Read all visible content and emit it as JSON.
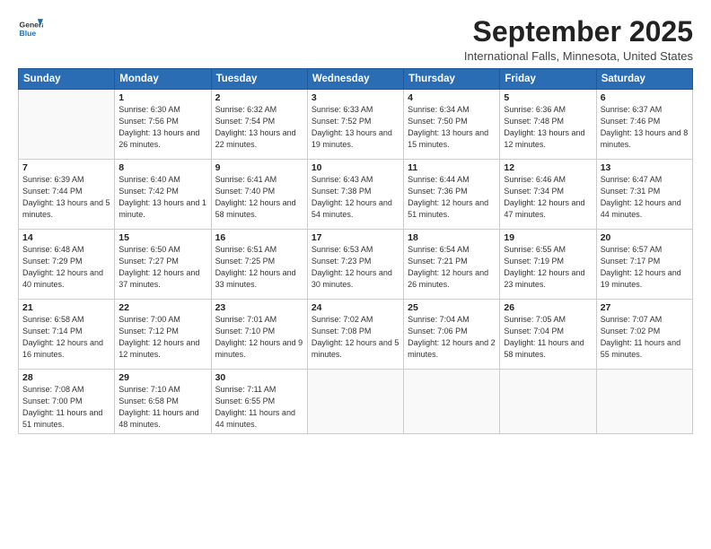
{
  "logo": {
    "line1": "General",
    "line2": "Blue"
  },
  "title": "September 2025",
  "subtitle": "International Falls, Minnesota, United States",
  "header": {
    "days": [
      "Sunday",
      "Monday",
      "Tuesday",
      "Wednesday",
      "Thursday",
      "Friday",
      "Saturday"
    ]
  },
  "weeks": [
    [
      {
        "day": "",
        "sunrise": "",
        "sunset": "",
        "daylight": ""
      },
      {
        "day": "1",
        "sunrise": "Sunrise: 6:30 AM",
        "sunset": "Sunset: 7:56 PM",
        "daylight": "Daylight: 13 hours and 26 minutes."
      },
      {
        "day": "2",
        "sunrise": "Sunrise: 6:32 AM",
        "sunset": "Sunset: 7:54 PM",
        "daylight": "Daylight: 13 hours and 22 minutes."
      },
      {
        "day": "3",
        "sunrise": "Sunrise: 6:33 AM",
        "sunset": "Sunset: 7:52 PM",
        "daylight": "Daylight: 13 hours and 19 minutes."
      },
      {
        "day": "4",
        "sunrise": "Sunrise: 6:34 AM",
        "sunset": "Sunset: 7:50 PM",
        "daylight": "Daylight: 13 hours and 15 minutes."
      },
      {
        "day": "5",
        "sunrise": "Sunrise: 6:36 AM",
        "sunset": "Sunset: 7:48 PM",
        "daylight": "Daylight: 13 hours and 12 minutes."
      },
      {
        "day": "6",
        "sunrise": "Sunrise: 6:37 AM",
        "sunset": "Sunset: 7:46 PM",
        "daylight": "Daylight: 13 hours and 8 minutes."
      }
    ],
    [
      {
        "day": "7",
        "sunrise": "Sunrise: 6:39 AM",
        "sunset": "Sunset: 7:44 PM",
        "daylight": "Daylight: 13 hours and 5 minutes."
      },
      {
        "day": "8",
        "sunrise": "Sunrise: 6:40 AM",
        "sunset": "Sunset: 7:42 PM",
        "daylight": "Daylight: 13 hours and 1 minute."
      },
      {
        "day": "9",
        "sunrise": "Sunrise: 6:41 AM",
        "sunset": "Sunset: 7:40 PM",
        "daylight": "Daylight: 12 hours and 58 minutes."
      },
      {
        "day": "10",
        "sunrise": "Sunrise: 6:43 AM",
        "sunset": "Sunset: 7:38 PM",
        "daylight": "Daylight: 12 hours and 54 minutes."
      },
      {
        "day": "11",
        "sunrise": "Sunrise: 6:44 AM",
        "sunset": "Sunset: 7:36 PM",
        "daylight": "Daylight: 12 hours and 51 minutes."
      },
      {
        "day": "12",
        "sunrise": "Sunrise: 6:46 AM",
        "sunset": "Sunset: 7:34 PM",
        "daylight": "Daylight: 12 hours and 47 minutes."
      },
      {
        "day": "13",
        "sunrise": "Sunrise: 6:47 AM",
        "sunset": "Sunset: 7:31 PM",
        "daylight": "Daylight: 12 hours and 44 minutes."
      }
    ],
    [
      {
        "day": "14",
        "sunrise": "Sunrise: 6:48 AM",
        "sunset": "Sunset: 7:29 PM",
        "daylight": "Daylight: 12 hours and 40 minutes."
      },
      {
        "day": "15",
        "sunrise": "Sunrise: 6:50 AM",
        "sunset": "Sunset: 7:27 PM",
        "daylight": "Daylight: 12 hours and 37 minutes."
      },
      {
        "day": "16",
        "sunrise": "Sunrise: 6:51 AM",
        "sunset": "Sunset: 7:25 PM",
        "daylight": "Daylight: 12 hours and 33 minutes."
      },
      {
        "day": "17",
        "sunrise": "Sunrise: 6:53 AM",
        "sunset": "Sunset: 7:23 PM",
        "daylight": "Daylight: 12 hours and 30 minutes."
      },
      {
        "day": "18",
        "sunrise": "Sunrise: 6:54 AM",
        "sunset": "Sunset: 7:21 PM",
        "daylight": "Daylight: 12 hours and 26 minutes."
      },
      {
        "day": "19",
        "sunrise": "Sunrise: 6:55 AM",
        "sunset": "Sunset: 7:19 PM",
        "daylight": "Daylight: 12 hours and 23 minutes."
      },
      {
        "day": "20",
        "sunrise": "Sunrise: 6:57 AM",
        "sunset": "Sunset: 7:17 PM",
        "daylight": "Daylight: 12 hours and 19 minutes."
      }
    ],
    [
      {
        "day": "21",
        "sunrise": "Sunrise: 6:58 AM",
        "sunset": "Sunset: 7:14 PM",
        "daylight": "Daylight: 12 hours and 16 minutes."
      },
      {
        "day": "22",
        "sunrise": "Sunrise: 7:00 AM",
        "sunset": "Sunset: 7:12 PM",
        "daylight": "Daylight: 12 hours and 12 minutes."
      },
      {
        "day": "23",
        "sunrise": "Sunrise: 7:01 AM",
        "sunset": "Sunset: 7:10 PM",
        "daylight": "Daylight: 12 hours and 9 minutes."
      },
      {
        "day": "24",
        "sunrise": "Sunrise: 7:02 AM",
        "sunset": "Sunset: 7:08 PM",
        "daylight": "Daylight: 12 hours and 5 minutes."
      },
      {
        "day": "25",
        "sunrise": "Sunrise: 7:04 AM",
        "sunset": "Sunset: 7:06 PM",
        "daylight": "Daylight: 12 hours and 2 minutes."
      },
      {
        "day": "26",
        "sunrise": "Sunrise: 7:05 AM",
        "sunset": "Sunset: 7:04 PM",
        "daylight": "Daylight: 11 hours and 58 minutes."
      },
      {
        "day": "27",
        "sunrise": "Sunrise: 7:07 AM",
        "sunset": "Sunset: 7:02 PM",
        "daylight": "Daylight: 11 hours and 55 minutes."
      }
    ],
    [
      {
        "day": "28",
        "sunrise": "Sunrise: 7:08 AM",
        "sunset": "Sunset: 7:00 PM",
        "daylight": "Daylight: 11 hours and 51 minutes."
      },
      {
        "day": "29",
        "sunrise": "Sunrise: 7:10 AM",
        "sunset": "Sunset: 6:58 PM",
        "daylight": "Daylight: 11 hours and 48 minutes."
      },
      {
        "day": "30",
        "sunrise": "Sunrise: 7:11 AM",
        "sunset": "Sunset: 6:55 PM",
        "daylight": "Daylight: 11 hours and 44 minutes."
      },
      {
        "day": "",
        "sunrise": "",
        "sunset": "",
        "daylight": ""
      },
      {
        "day": "",
        "sunrise": "",
        "sunset": "",
        "daylight": ""
      },
      {
        "day": "",
        "sunrise": "",
        "sunset": "",
        "daylight": ""
      },
      {
        "day": "",
        "sunrise": "",
        "sunset": "",
        "daylight": ""
      }
    ]
  ]
}
